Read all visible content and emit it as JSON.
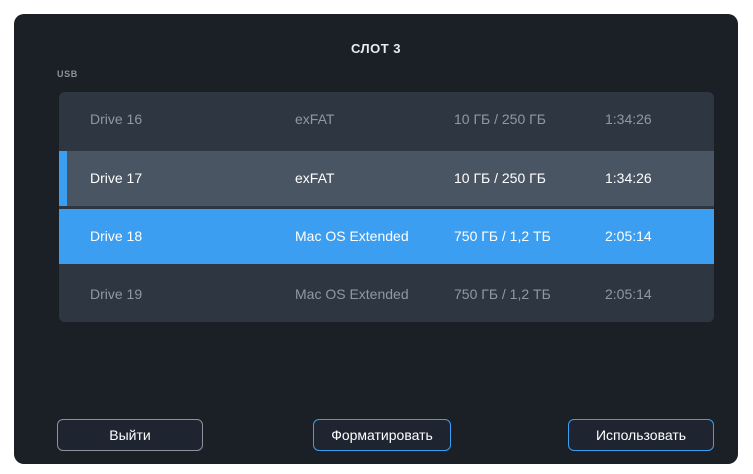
{
  "header": {
    "title": "СЛОТ 3"
  },
  "section": {
    "label": "USB"
  },
  "drives": [
    {
      "name": "Drive 16",
      "filesystem": "exFAT",
      "capacity": "10 ГБ / 250 ГБ",
      "remaining_time": "1:34:26"
    },
    {
      "name": "Drive 17",
      "filesystem": "exFAT",
      "capacity": "10 ГБ / 250 ГБ",
      "remaining_time": "1:34:26"
    },
    {
      "name": "Drive 18",
      "filesystem": "Mac OS Extended",
      "capacity": "750 ГБ / 1,2 ТБ",
      "remaining_time": "2:05:14"
    },
    {
      "name": "Drive 19",
      "filesystem": "Mac OS Extended",
      "capacity": "750 ГБ / 1,2 ТБ",
      "remaining_time": "2:05:14"
    }
  ],
  "selection": {
    "active_drive": "Drive 17",
    "highlighted_drive": "Drive 18"
  },
  "buttons": {
    "exit_label": "Выйти",
    "format_label": "Форматировать",
    "use_label": "Использовать"
  },
  "colors": {
    "background": "#1b1f26",
    "list_background": "#2e3642",
    "active_row": "#4a5564",
    "accent": "#3c9ef0"
  }
}
